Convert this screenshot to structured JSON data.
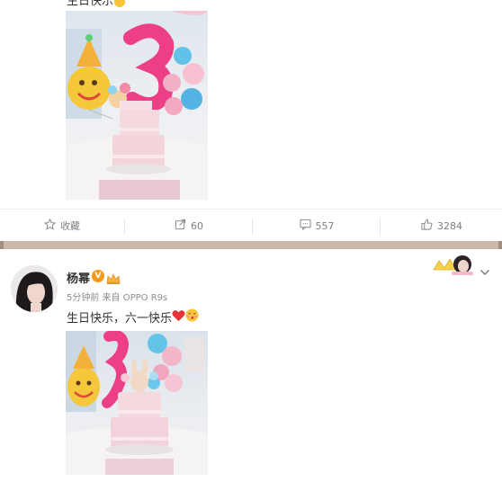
{
  "top_post": {
    "text": "生日快乐"
  },
  "actions": {
    "favorite_label": "收藏",
    "repost_count": "60",
    "comment_count": "557",
    "like_count": "3284"
  },
  "second_post": {
    "username": "杨幂",
    "verified_badge": "V",
    "meta": "5分钟前 来自 OPPO R9s",
    "text": "生日快乐，六一快乐"
  },
  "icons": [
    "star-icon",
    "repost-icon",
    "comment-icon",
    "thumbs-up-icon",
    "chevron-down-icon",
    "heart-emoji-icon",
    "kiss-emoji-icon",
    "crown-badge-icon"
  ],
  "colors": {
    "divider": "#c9b9ad",
    "verified": "#f39a1c",
    "muted_text": "#8c8c8c"
  }
}
